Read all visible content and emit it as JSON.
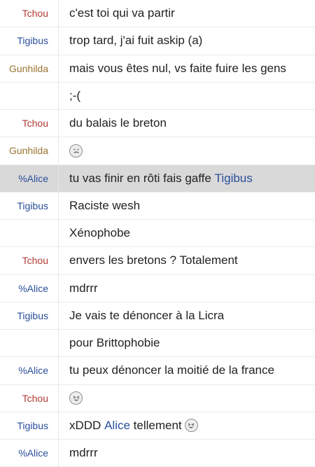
{
  "colors": {
    "nick_Tchou": "#b03a32",
    "nick_Tigibus": "#2a4f9a",
    "nick_Gunhilda": "#9a7432",
    "nick_%Alice": "#2a4f9a",
    "mention": "#2a4f9a",
    "highlight_row": "#d9d9d9"
  },
  "messages": [
    {
      "nick": "Tchou",
      "text": "c'est toi qui va partir"
    },
    {
      "nick": "Tigibus",
      "text": "trop tard, j'ai fuit askip (a)"
    },
    {
      "nick": "Gunhilda",
      "text": "mais vous êtes nul, vs faite fuire les gens"
    },
    {
      "nick": "",
      "text": ";-("
    },
    {
      "nick": "Tchou",
      "text": "du balais le breton"
    },
    {
      "nick": "Gunhilda",
      "text": "",
      "emoji": "sad-face"
    },
    {
      "nick": "%Alice",
      "text": "tu vas finir en rôti fais gaffe ",
      "mention": "Tigibus",
      "highlight": true
    },
    {
      "nick": "Tigibus",
      "text": "Raciste wesh"
    },
    {
      "nick": "",
      "text": "Xénophobe"
    },
    {
      "nick": "Tchou",
      "text": "envers les bretons ? Totalement"
    },
    {
      "nick": "%Alice",
      "text": "mdrrr"
    },
    {
      "nick": "Tigibus",
      "text": "Je vais te dénoncer à la Licra"
    },
    {
      "nick": "",
      "text": "pour Brittophobie"
    },
    {
      "nick": "%Alice",
      "text": "tu peux dénoncer la moitié de la france"
    },
    {
      "nick": "Tchou",
      "text": "",
      "emoji": "laughing-face"
    },
    {
      "nick": "Tigibus",
      "text": "xDDD ",
      "mention": "Alice",
      "text_after": " tellement",
      "emoji": "laughing-face"
    },
    {
      "nick": "%Alice",
      "text": "mdrrr"
    }
  ]
}
